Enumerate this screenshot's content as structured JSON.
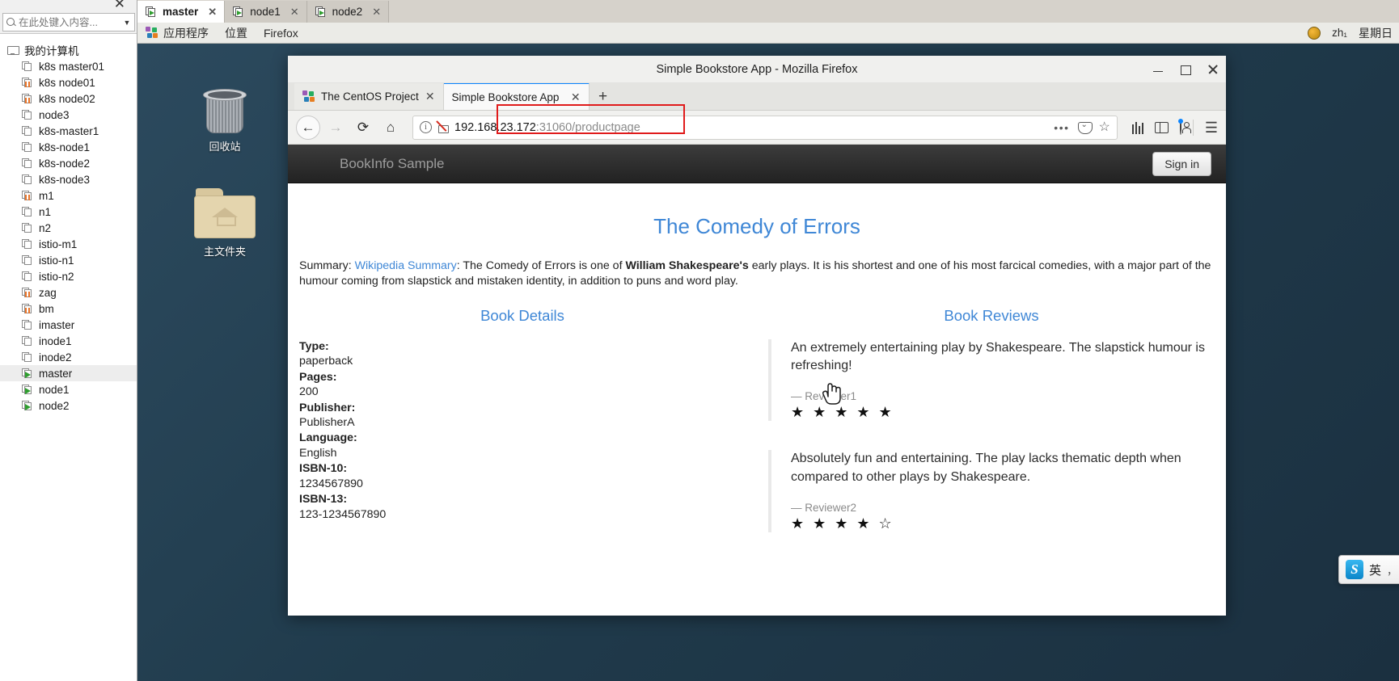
{
  "vm_panel": {
    "close_label": "✕",
    "search_placeholder": "在此处键入内容...",
    "caret": "▼",
    "tree": [
      {
        "label": "我的计算机",
        "icon": "monitor-icon",
        "state": "root",
        "indent": 0,
        "selected": false
      },
      {
        "label": "k8s master01",
        "icon": "vm-icon",
        "state": "off",
        "indent": 1,
        "selected": false
      },
      {
        "label": "k8s node01",
        "icon": "vm-icon",
        "state": "suspended",
        "indent": 1,
        "selected": false
      },
      {
        "label": "k8s node02",
        "icon": "vm-icon",
        "state": "suspended",
        "indent": 1,
        "selected": false
      },
      {
        "label": "node3",
        "icon": "vm-icon",
        "state": "off",
        "indent": 1,
        "selected": false
      },
      {
        "label": "k8s-master1",
        "icon": "vm-icon",
        "state": "off",
        "indent": 1,
        "selected": false
      },
      {
        "label": "k8s-node1",
        "icon": "vm-icon",
        "state": "off",
        "indent": 1,
        "selected": false
      },
      {
        "label": "k8s-node2",
        "icon": "vm-icon",
        "state": "off",
        "indent": 1,
        "selected": false
      },
      {
        "label": "k8s-node3",
        "icon": "vm-icon",
        "state": "off",
        "indent": 1,
        "selected": false
      },
      {
        "label": "m1",
        "icon": "vm-icon",
        "state": "suspended",
        "indent": 1,
        "selected": false
      },
      {
        "label": "n1",
        "icon": "vm-icon",
        "state": "off",
        "indent": 1,
        "selected": false
      },
      {
        "label": "n2",
        "icon": "vm-icon",
        "state": "off",
        "indent": 1,
        "selected": false
      },
      {
        "label": "istio-m1",
        "icon": "vm-icon",
        "state": "off",
        "indent": 1,
        "selected": false
      },
      {
        "label": "istio-n1",
        "icon": "vm-icon",
        "state": "off",
        "indent": 1,
        "selected": false
      },
      {
        "label": "istio-n2",
        "icon": "vm-icon",
        "state": "off",
        "indent": 1,
        "selected": false
      },
      {
        "label": "zag",
        "icon": "vm-icon",
        "state": "suspended",
        "indent": 1,
        "selected": false
      },
      {
        "label": "bm",
        "icon": "vm-icon",
        "state": "suspended",
        "indent": 1,
        "selected": false
      },
      {
        "label": "imaster",
        "icon": "vm-icon",
        "state": "off",
        "indent": 1,
        "selected": false
      },
      {
        "label": "inode1",
        "icon": "vm-icon",
        "state": "off",
        "indent": 1,
        "selected": false
      },
      {
        "label": "inode2",
        "icon": "vm-icon",
        "state": "off",
        "indent": 1,
        "selected": false
      },
      {
        "label": "master",
        "icon": "vm-icon",
        "state": "running",
        "indent": 1,
        "selected": true
      },
      {
        "label": "node1",
        "icon": "vm-icon",
        "state": "running",
        "indent": 1,
        "selected": false
      },
      {
        "label": "node2",
        "icon": "vm-icon",
        "state": "running",
        "indent": 1,
        "selected": false
      }
    ]
  },
  "vm_tabs": [
    {
      "label": "master",
      "active": true,
      "close": "✕"
    },
    {
      "label": "node1",
      "active": false,
      "close": "✕"
    },
    {
      "label": "node2",
      "active": false,
      "close": "✕"
    }
  ],
  "gnome_panel": {
    "applications": "应用程序",
    "places": "位置",
    "firefox": "Firefox",
    "language": "zh₁",
    "datetime": "星期日"
  },
  "desktop": {
    "icons": [
      {
        "label": "回收站",
        "icon": "trash-icon"
      },
      {
        "label": "主文件夹",
        "icon": "home-folder-icon"
      }
    ]
  },
  "firefox": {
    "window_title": "Simple Bookstore App - Mozilla Firefox",
    "window_buttons": {
      "minimize": "minimize-icon",
      "maximize": "maximize-icon",
      "close": "close-icon"
    },
    "tabs": [
      {
        "label": "The CentOS Project",
        "active": false,
        "close": "✕"
      },
      {
        "label": "Simple Bookstore App",
        "active": true,
        "close": "✕"
      }
    ],
    "new_tab": "+",
    "nav": {
      "back": "←",
      "forward": "→",
      "reload": "⟳",
      "home": "⌂"
    },
    "url": {
      "host": "192.168.23.172",
      "rest": ":31060/productpage",
      "full": "192.168.23.172:31060/productpage"
    },
    "url_actions": {
      "page_actions": "•••",
      "pocket": "pocket-icon",
      "bookmark": "star-icon"
    },
    "toolbar_right": {
      "library": "library-icon",
      "sidebar": "sidebar-icon",
      "account": "account-icon",
      "menu": "☰"
    },
    "highlight_color": "#e01b1b"
  },
  "bookinfo": {
    "brand": "BookInfo Sample",
    "signin": "Sign in",
    "title": "The Comedy of Errors",
    "summary": {
      "prefix": "Summary: ",
      "link": "Wikipedia Summary",
      "part1": ": The Comedy of Errors is one of ",
      "bold": "William Shakespeare's",
      "part2": " early plays. It is his shortest and one of his most farcical comedies, with a major part of the humour coming from slapstick and mistaken identity, in addition to puns and word play."
    },
    "details_heading": "Book Details",
    "details": [
      {
        "label": "Type:",
        "value": "paperback"
      },
      {
        "label": "Pages:",
        "value": "200"
      },
      {
        "label": "Publisher:",
        "value": "PublisherA"
      },
      {
        "label": "Language:",
        "value": "English"
      },
      {
        "label": "ISBN-10:",
        "value": "1234567890"
      },
      {
        "label": "ISBN-13:",
        "value": "123-1234567890"
      }
    ],
    "reviews_heading": "Book Reviews",
    "reviews": [
      {
        "text": "An extremely entertaining play by Shakespeare. The slapstick humour is refreshing!",
        "reviewer": "— Reviewer1",
        "stars": "★ ★ ★ ★ ★",
        "rating": 5
      },
      {
        "text": "Absolutely fun and entertaining. The play lacks thematic depth when compared to other plays by Shakespeare.",
        "reviewer": "— Reviewer2",
        "stars": "★ ★ ★ ★ ☆",
        "rating": 4
      }
    ]
  },
  "ime": {
    "logo": "S",
    "mode": "英",
    "punct": "，"
  }
}
